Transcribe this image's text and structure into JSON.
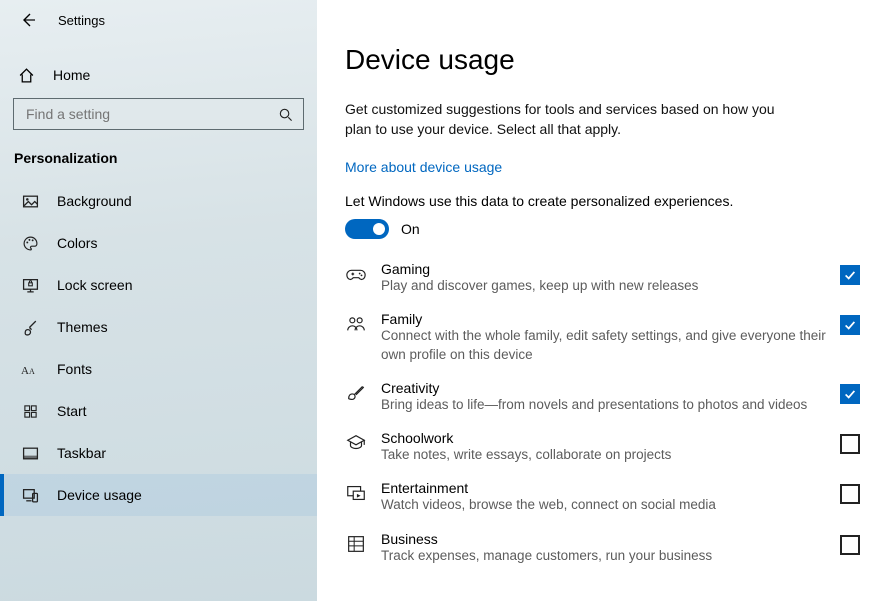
{
  "titlebar": {
    "app": "Settings"
  },
  "sidebar": {
    "home": "Home",
    "search_placeholder": "Find a setting",
    "section": "Personalization",
    "items": [
      {
        "label": "Background",
        "icon": "picture"
      },
      {
        "label": "Colors",
        "icon": "palette"
      },
      {
        "label": "Lock screen",
        "icon": "lock-monitor"
      },
      {
        "label": "Themes",
        "icon": "brush"
      },
      {
        "label": "Fonts",
        "icon": "fonts"
      },
      {
        "label": "Start",
        "icon": "start"
      },
      {
        "label": "Taskbar",
        "icon": "taskbar"
      },
      {
        "label": "Device usage",
        "icon": "device-usage"
      }
    ],
    "active_index": 7
  },
  "page": {
    "title": "Device usage",
    "description": "Get customized suggestions for tools and services based on how you plan to use your device. Select all that apply.",
    "link": "More about device usage",
    "toggle_caption": "Let Windows use this data to create personalized experiences.",
    "toggle_state": "On",
    "options": [
      {
        "title": "Gaming",
        "sub": "Play and discover games, keep up with new releases",
        "checked": true
      },
      {
        "title": "Family",
        "sub": "Connect with the whole family, edit safety settings, and give everyone their own profile on this device",
        "checked": true
      },
      {
        "title": "Creativity",
        "sub": "Bring ideas to life—from novels and presentations to photos and videos",
        "checked": true
      },
      {
        "title": "Schoolwork",
        "sub": "Take notes, write essays, collaborate on projects",
        "checked": false
      },
      {
        "title": "Entertainment",
        "sub": "Watch videos, browse the web, connect on social media",
        "checked": false
      },
      {
        "title": "Business",
        "sub": "Track expenses, manage customers, run your business",
        "checked": false
      }
    ]
  }
}
